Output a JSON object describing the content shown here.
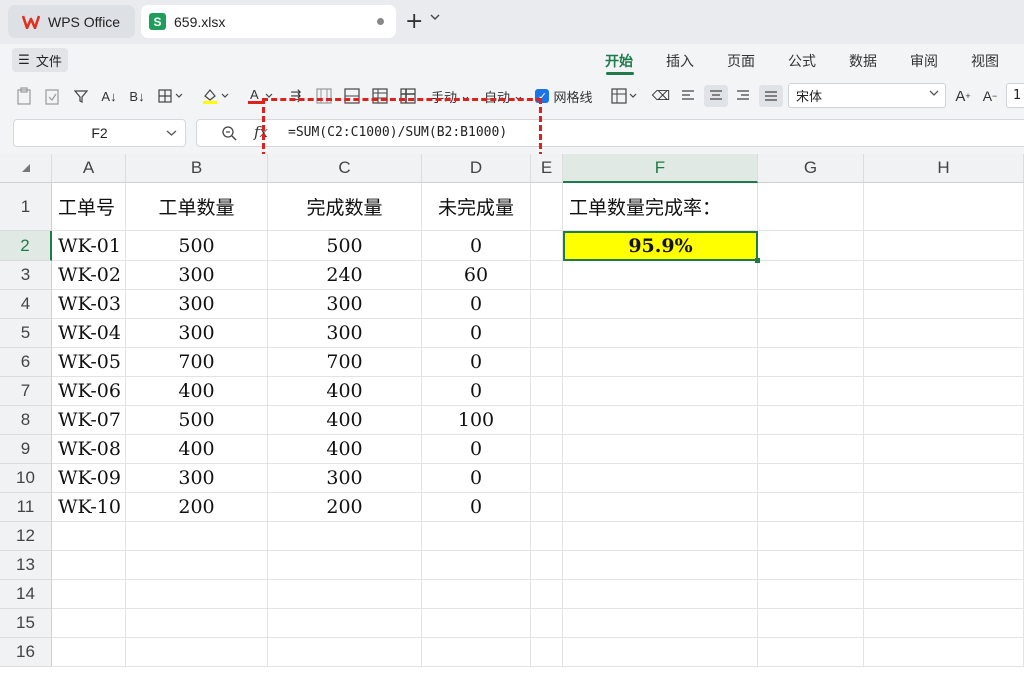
{
  "titlebar": {
    "app_tab": "WPS Office",
    "file_tab": "659.xlsx",
    "file_badge": "S"
  },
  "menu": {
    "file_label": "文件",
    "tabs": [
      "开始",
      "插入",
      "页面",
      "公式",
      "数据",
      "审阅",
      "视图"
    ],
    "active_tab": "开始"
  },
  "toolbar": {
    "manual_label": "手动",
    "auto_label": "自动",
    "gridlines_label": "网格线",
    "gridlines_checked": true,
    "font_name": "宋体",
    "font_size": "1"
  },
  "formula_bar": {
    "name_box": "F2",
    "fx_label": "fx",
    "formula": "=SUM(C2:C1000)/SUM(B2:B1000)"
  },
  "sheet": {
    "columns": [
      "A",
      "B",
      "C",
      "D",
      "E",
      "F",
      "G",
      "H"
    ],
    "row_numbers": [
      "1",
      "2",
      "3",
      "4",
      "5",
      "6",
      "7",
      "8",
      "9",
      "10",
      "11",
      "12",
      "13",
      "14",
      "15",
      "16"
    ],
    "headers": {
      "A": "工单号",
      "B": "工单数量",
      "C": "完成数量",
      "D": "未完成量",
      "F": "工单数量完成率："
    },
    "rows": [
      [
        "WK-01",
        "500",
        "500",
        "0"
      ],
      [
        "WK-02",
        "300",
        "240",
        "60"
      ],
      [
        "WK-03",
        "300",
        "300",
        "0"
      ],
      [
        "WK-04",
        "300",
        "300",
        "0"
      ],
      [
        "WK-05",
        "700",
        "700",
        "0"
      ],
      [
        "WK-06",
        "400",
        "400",
        "0"
      ],
      [
        "WK-07",
        "500",
        "400",
        "100"
      ],
      [
        "WK-08",
        "400",
        "400",
        "0"
      ],
      [
        "WK-09",
        "300",
        "300",
        "0"
      ],
      [
        "WK-10",
        "200",
        "200",
        "0"
      ]
    ],
    "result_value": "95.9%",
    "selected_cell": "F2",
    "selected_fill": "#ffff00",
    "accent": "#1e7b4a",
    "highlight_border": "#e0201c"
  }
}
